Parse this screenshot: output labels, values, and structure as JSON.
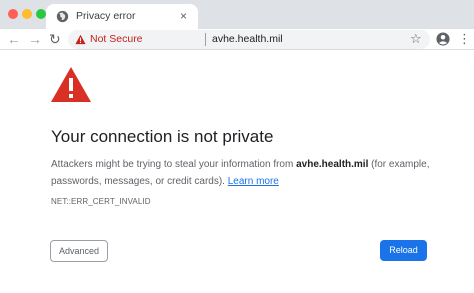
{
  "window": {
    "tab_title": "Privacy error",
    "tab_close": "×"
  },
  "toolbar": {
    "back_glyph": "←",
    "forward_glyph": "→",
    "reload_glyph": "↻",
    "security_label": "Not Secure",
    "url": "avhe.health.mil",
    "bookmark_glyph": "☆",
    "menu_glyph": "⋮"
  },
  "page": {
    "heading": "Your connection is not private",
    "description_prefix": "Attackers might be trying to steal your information from ",
    "description_host": "avhe.health.mil",
    "description_suffix": " (for example, passwords, messages, or credit cards). ",
    "learn_more": "Learn more",
    "error_code": "NET::ERR_CERT_INVALID",
    "advanced_button": "Advanced",
    "reload_button": "Reload"
  },
  "icons": {
    "tab": "globe-icon",
    "omnibox_warning": "warning-icon",
    "bookmark": "star-icon",
    "profile": "account-icon",
    "menu": "kebab-menu-icon",
    "page_warning": "large-warning-icon"
  },
  "colors": {
    "titlebar": "#dee1e6",
    "danger": "#c5221f",
    "warning_red": "#d93025",
    "link": "#1a73e8",
    "primary_button": "#1a73e8",
    "text_secondary": "#5f6368"
  }
}
